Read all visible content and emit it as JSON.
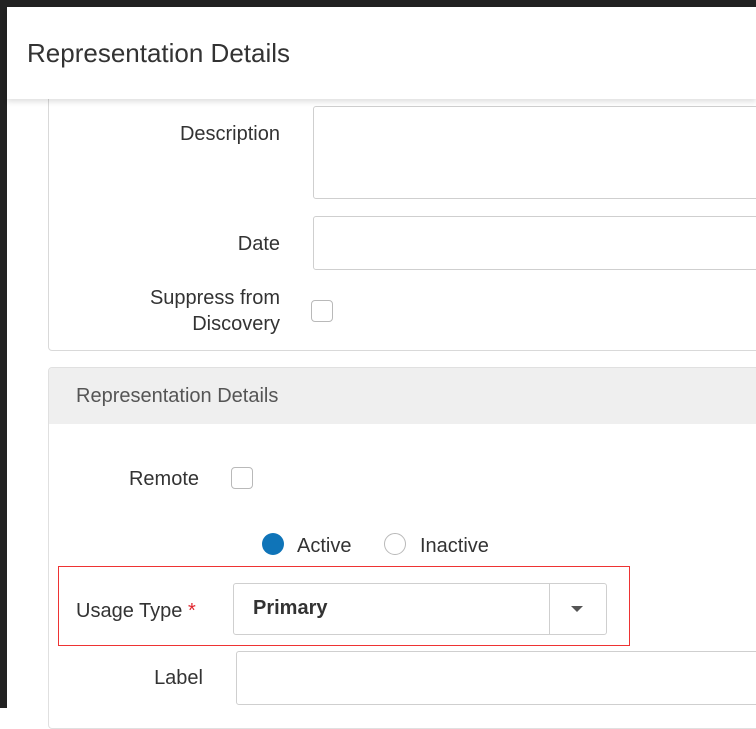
{
  "header": {
    "title": "Representation Details"
  },
  "form": {
    "description_label": "Description",
    "description_value": "",
    "date_label": "Date",
    "date_value": "",
    "suppress_label_line1": "Suppress from",
    "suppress_label_line2": "Discovery",
    "suppress_checked": false
  },
  "section": {
    "title": "Representation Details",
    "remote_label": "Remote",
    "remote_checked": false,
    "status_options": [
      {
        "label": "Active",
        "selected": true
      },
      {
        "label": "Inactive",
        "selected": false
      }
    ],
    "usage_type_label": "Usage Type",
    "required_marker": "*",
    "usage_type_value": "Primary",
    "label_label": "Label",
    "label_value": ""
  },
  "colors": {
    "accent": "#0f74b8",
    "highlight_border": "#e33333",
    "required": "#e0262f"
  }
}
